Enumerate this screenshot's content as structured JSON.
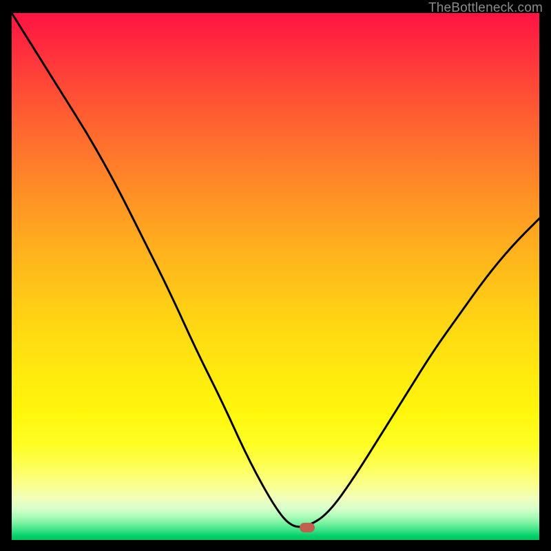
{
  "watermark": "TheBottleneck.com",
  "colors": {
    "frame": "#000000",
    "curve_stroke": "#000000",
    "marker_fill": "#c1604f",
    "watermark_text": "#8b8b8b"
  },
  "marker": {
    "x_frac": 0.56,
    "y_frac": 0.976
  },
  "chart_data": {
    "type": "line",
    "title": "",
    "xlabel": "",
    "ylabel": "",
    "xlim": [
      0,
      1
    ],
    "ylim": [
      0,
      1
    ],
    "series": [
      {
        "name": "bottleneck-curve",
        "x": [
          0.0,
          0.05,
          0.1,
          0.15,
          0.2,
          0.25,
          0.3,
          0.35,
          0.4,
          0.45,
          0.5,
          0.53,
          0.56,
          0.6,
          0.65,
          0.7,
          0.75,
          0.8,
          0.85,
          0.9,
          0.95,
          1.0
        ],
        "y": [
          1.0,
          0.92,
          0.84,
          0.76,
          0.67,
          0.57,
          0.47,
          0.36,
          0.26,
          0.15,
          0.06,
          0.025,
          0.025,
          0.05,
          0.12,
          0.2,
          0.28,
          0.36,
          0.43,
          0.5,
          0.56,
          0.61
        ]
      }
    ],
    "annotations": [
      {
        "name": "optimal-marker",
        "x": 0.56,
        "y": 0.024
      }
    ]
  }
}
